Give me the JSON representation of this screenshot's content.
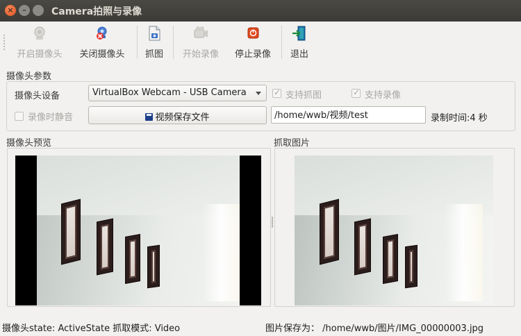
{
  "window": {
    "title": "Camera拍照与录像",
    "controls": [
      "close-icon",
      "minimize-icon",
      "maximize-icon"
    ]
  },
  "toolbar": {
    "items": [
      {
        "label": "开启摄像头",
        "icon": "webcam-icon",
        "enabled": false
      },
      {
        "label": "关闭摄像头",
        "icon": "webcam-off-icon",
        "enabled": true
      },
      {
        "label": "抓图",
        "icon": "capture-image-icon",
        "enabled": true
      },
      {
        "label": "开始录像",
        "icon": "video-camera-icon",
        "enabled": false
      },
      {
        "label": "停止录像",
        "icon": "stop-record-icon",
        "enabled": true
      },
      {
        "label": "退出",
        "icon": "exit-icon",
        "enabled": true
      }
    ]
  },
  "params": {
    "group_title": "摄像头参数",
    "device_label": "摄像头设备",
    "device_value": "VirtualBox Webcam - USB Camera",
    "support_capture_label": "支持抓图",
    "support_capture_checked": true,
    "support_record_label": "支持录像",
    "support_record_checked": true,
    "mute_label": "录像时静音",
    "mute_checked": false,
    "save_button_label": "视频保存文件",
    "save_path": "/home/wwb/视频/test",
    "record_time": "录制时间:4 秒"
  },
  "preview": {
    "title": "摄像头预览"
  },
  "captured": {
    "title": "抓取图片"
  },
  "status": {
    "left": "摄像头state: ActiveState  抓取模式: Video",
    "right": "图片保存为： /home/wwb/图片/IMG_00000003.jpg"
  },
  "colors": {
    "titlebar": "#3c3b37",
    "close_button": "#e0521c",
    "window_bg": "#f2f1f0"
  }
}
